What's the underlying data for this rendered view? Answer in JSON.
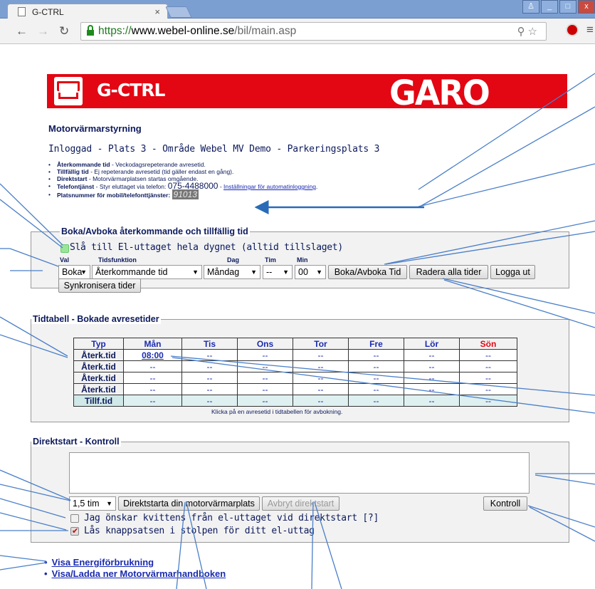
{
  "browser": {
    "tab_title": "G-CTRL",
    "tab_close": "×",
    "url_https": "https://",
    "url_domain": "www.webel-online.se",
    "url_path": "/bil/main.asp"
  },
  "banner": {
    "left_logo": "G-CTRL",
    "right_logo": "GARO"
  },
  "header": {
    "title": "Motorvärmarstyrning",
    "login_line": "Inloggad - Plats 3 - Område Webel MV Demo - Parkeringsplats 3"
  },
  "info": [
    {
      "term": "Återkommande tid",
      "desc": " - Veckodagsrepeterande avresetid."
    },
    {
      "term": "Tillfällig tid",
      "desc": " - Ej repeterande avresetid (tid gäller endast en gång)."
    },
    {
      "term": "Direktstart",
      "desc": " - Motorvärmarplatsen startas omgående."
    },
    {
      "term": "Telefontjänst",
      "desc": " - Styr eluttaget via telefon: ",
      "phone": "075-4488000",
      "sep": " - ",
      "link": "Inställningar för automatinloggning",
      "end": "."
    },
    {
      "term": "Platsnummer för mobil/telefonttjänster:",
      "value": "91013"
    }
  ],
  "boka": {
    "legend": "Boka/Avboka återkommande och tillfällig tid",
    "allday_label": "Slå till El-uttaget hela dygnet (alltid tillslaget)",
    "labels": {
      "val": "Val",
      "tidsfunktion": "Tidsfunktion",
      "dag": "Dag",
      "tim": "Tim",
      "min": "Min"
    },
    "val_selected": "Boka",
    "tidsfunktion_selected": "Återkommande tid",
    "dag_selected": "Måndag",
    "tim_selected": "--",
    "min_selected": "00",
    "btn_boka": "Boka/Avboka Tid",
    "btn_radera": "Radera alla tider",
    "btn_logout": "Logga ut",
    "btn_sync": "Synkronisera tider"
  },
  "tidtabell": {
    "legend": "Tidtabell - Bokade avresetider",
    "columns": [
      "Typ",
      "Mån",
      "Tis",
      "Ons",
      "Tor",
      "Fre",
      "Lör",
      "Sön"
    ],
    "rows": [
      [
        "Återk.tid",
        "08:00",
        "--",
        "--",
        "--",
        "--",
        "--",
        "--"
      ],
      [
        "Återk.tid",
        "--",
        "--",
        "--",
        "--",
        "--",
        "--",
        "--"
      ],
      [
        "Återk.tid",
        "--",
        "--",
        "--",
        "--",
        "--",
        "--",
        "--"
      ],
      [
        "Återk.tid",
        "--",
        "--",
        "--",
        "--",
        "--",
        "--",
        "--"
      ],
      [
        "Tillf.tid",
        "--",
        "--",
        "--",
        "--",
        "--",
        "--",
        "--"
      ]
    ],
    "note": "Klicka på en avresetid i tidtabellen för avbokning."
  },
  "direkt": {
    "legend": "Direktstart - Kontroll",
    "duration_selected": "1,5 tim",
    "btn_start": "Direktstarta din motorvärmarplats",
    "btn_abort": "Avbryt direktstart",
    "btn_kontroll": "Kontroll",
    "cb_kvittens": "Jag önskar kvittens från el-uttaget vid direktstart [?]",
    "cb_las": "Lås knappsatsen i stolpen för ditt el-uttag",
    "cb_las_checked": true,
    "cb_kvittens_checked": false
  },
  "links": [
    "Visa Energiförbrukning",
    "Visa/Ladda ner Motorvärmarhandboken"
  ],
  "colors": {
    "brand_red": "#e30613",
    "navy": "#0c1a5c",
    "link": "#1a2bb0",
    "annotation": "#4a7fc9"
  }
}
